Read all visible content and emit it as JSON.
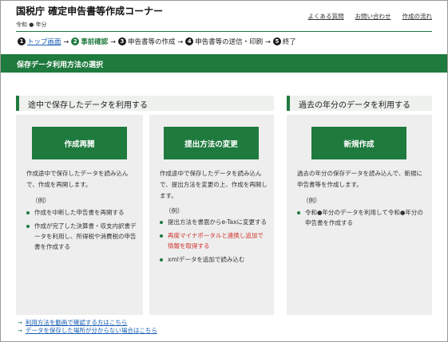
{
  "header": {
    "title": "国税庁 確定申告書等作成コーナー",
    "era_prefix": "令和",
    "era_dot": "●",
    "era_suffix": "年分",
    "links": [
      "よくある質問",
      "お問い合わせ",
      "作成の流れ"
    ]
  },
  "steps": [
    {
      "num": "1",
      "label": "トップ画面"
    },
    {
      "num": "2",
      "label": "事前確認"
    },
    {
      "num": "3",
      "label": "申告書等の作成"
    },
    {
      "num": "4",
      "label": "申告書等の送信・印刷"
    },
    {
      "num": "5",
      "label": "終了"
    }
  ],
  "step_arrow": "→",
  "banner": {
    "title": "保存データ利用方法の選択"
  },
  "sections": {
    "left": {
      "title": "途中で保存したデータを利用する"
    },
    "right": {
      "title": "過去の年分のデータを利用する"
    }
  },
  "cards": [
    {
      "button": "作成再開",
      "desc": "作成途中で保存したデータを読み込んで、作成を再開します。",
      "example": "（例）",
      "items": [
        "作成を中断した申告書を再開する",
        "作成が完了した決算書・収支内訳書データを利用し、所得税や消費税の申告書を作成する"
      ]
    },
    {
      "button": "提出方法の変更",
      "desc": "作成途中で保存したデータを読み込んで、提出方法を変更の上、作成を再開します。",
      "example": "（例）",
      "items": [
        "提出方法を書面からe-Taxに変更する",
        "再度マイナポータルと連携し追加で情報を取得する",
        "xmlデータを追加で読み込む"
      ]
    },
    {
      "button": "新規作成",
      "desc": "過去の年分の保存データを読み込んで、新規に申告書等を作成します。",
      "example": "（例）",
      "items": [
        "令和●年分のデータを利用して令和●年分の申告書を作成する"
      ]
    }
  ],
  "footer": {
    "links": [
      "利用方法を動画で確認する方はこちら",
      "データを保存した場所が分からない場合はこちら"
    ],
    "arrow": "→"
  },
  "colors": {
    "brand_green": "#1f7a3e",
    "link_blue": "#1a5fb4",
    "alert_red": "#d0322d",
    "card_bg": "#eeeeee"
  }
}
